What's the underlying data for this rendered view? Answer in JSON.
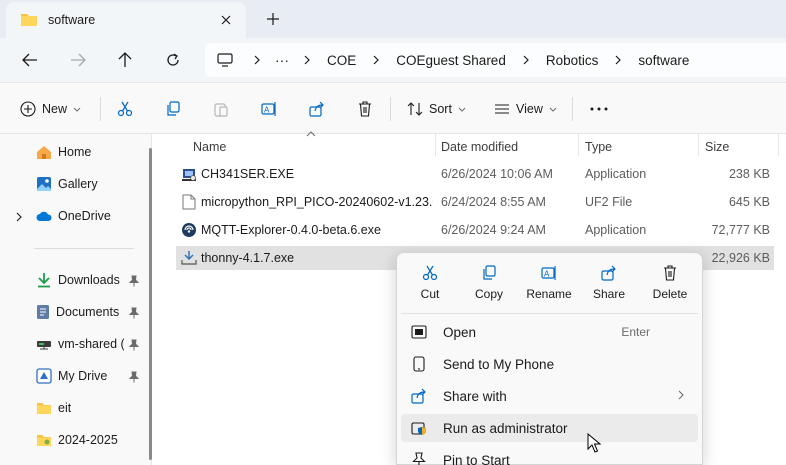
{
  "tab": {
    "title": "software"
  },
  "breadcrumb": [
    "COE",
    "COEguest Shared",
    "Robotics",
    "software"
  ],
  "commands": {
    "new": "New",
    "sort": "Sort",
    "view": "View"
  },
  "sidebar": {
    "items": [
      {
        "label": "Home"
      },
      {
        "label": "Gallery"
      },
      {
        "label": "OneDrive"
      }
    ],
    "quick": [
      {
        "label": "Downloads",
        "pinned": true
      },
      {
        "label": "Documents",
        "pinned": true
      },
      {
        "label": "vm-shared (\\",
        "pinned": true
      },
      {
        "label": "My Drive",
        "pinned": true
      },
      {
        "label": "eit",
        "pinned": false
      },
      {
        "label": "2024-2025",
        "pinned": false
      }
    ]
  },
  "columns": {
    "name": "Name",
    "date": "Date modified",
    "type": "Type",
    "size": "Size"
  },
  "files": [
    {
      "name": "CH341SER.EXE",
      "date": "6/26/2024 10:06 AM",
      "type": "Application",
      "size": "238 KB"
    },
    {
      "name": "micropython_RPI_PICO-20240602-v1.23.0...",
      "date": "6/24/2024 8:55 AM",
      "type": "UF2 File",
      "size": "645 KB"
    },
    {
      "name": "MQTT-Explorer-0.4.0-beta.6.exe",
      "date": "6/26/2024 9:24 AM",
      "type": "Application",
      "size": "72,777 KB"
    },
    {
      "name": "thonny-4.1.7.exe",
      "date": "",
      "type": "",
      "size": "22,926 KB"
    }
  ],
  "context_menu": {
    "quick_actions": [
      "Cut",
      "Copy",
      "Rename",
      "Share",
      "Delete"
    ],
    "items": [
      {
        "label": "Open",
        "shortcut": "Enter"
      },
      {
        "label": "Send to My Phone"
      },
      {
        "label": "Share with"
      },
      {
        "label": "Run as administrator"
      },
      {
        "label": "Pin to Start"
      }
    ]
  },
  "colors": {
    "accent": "#0067c0",
    "folder": "#f6c342",
    "selection": "#e1e1e1"
  }
}
